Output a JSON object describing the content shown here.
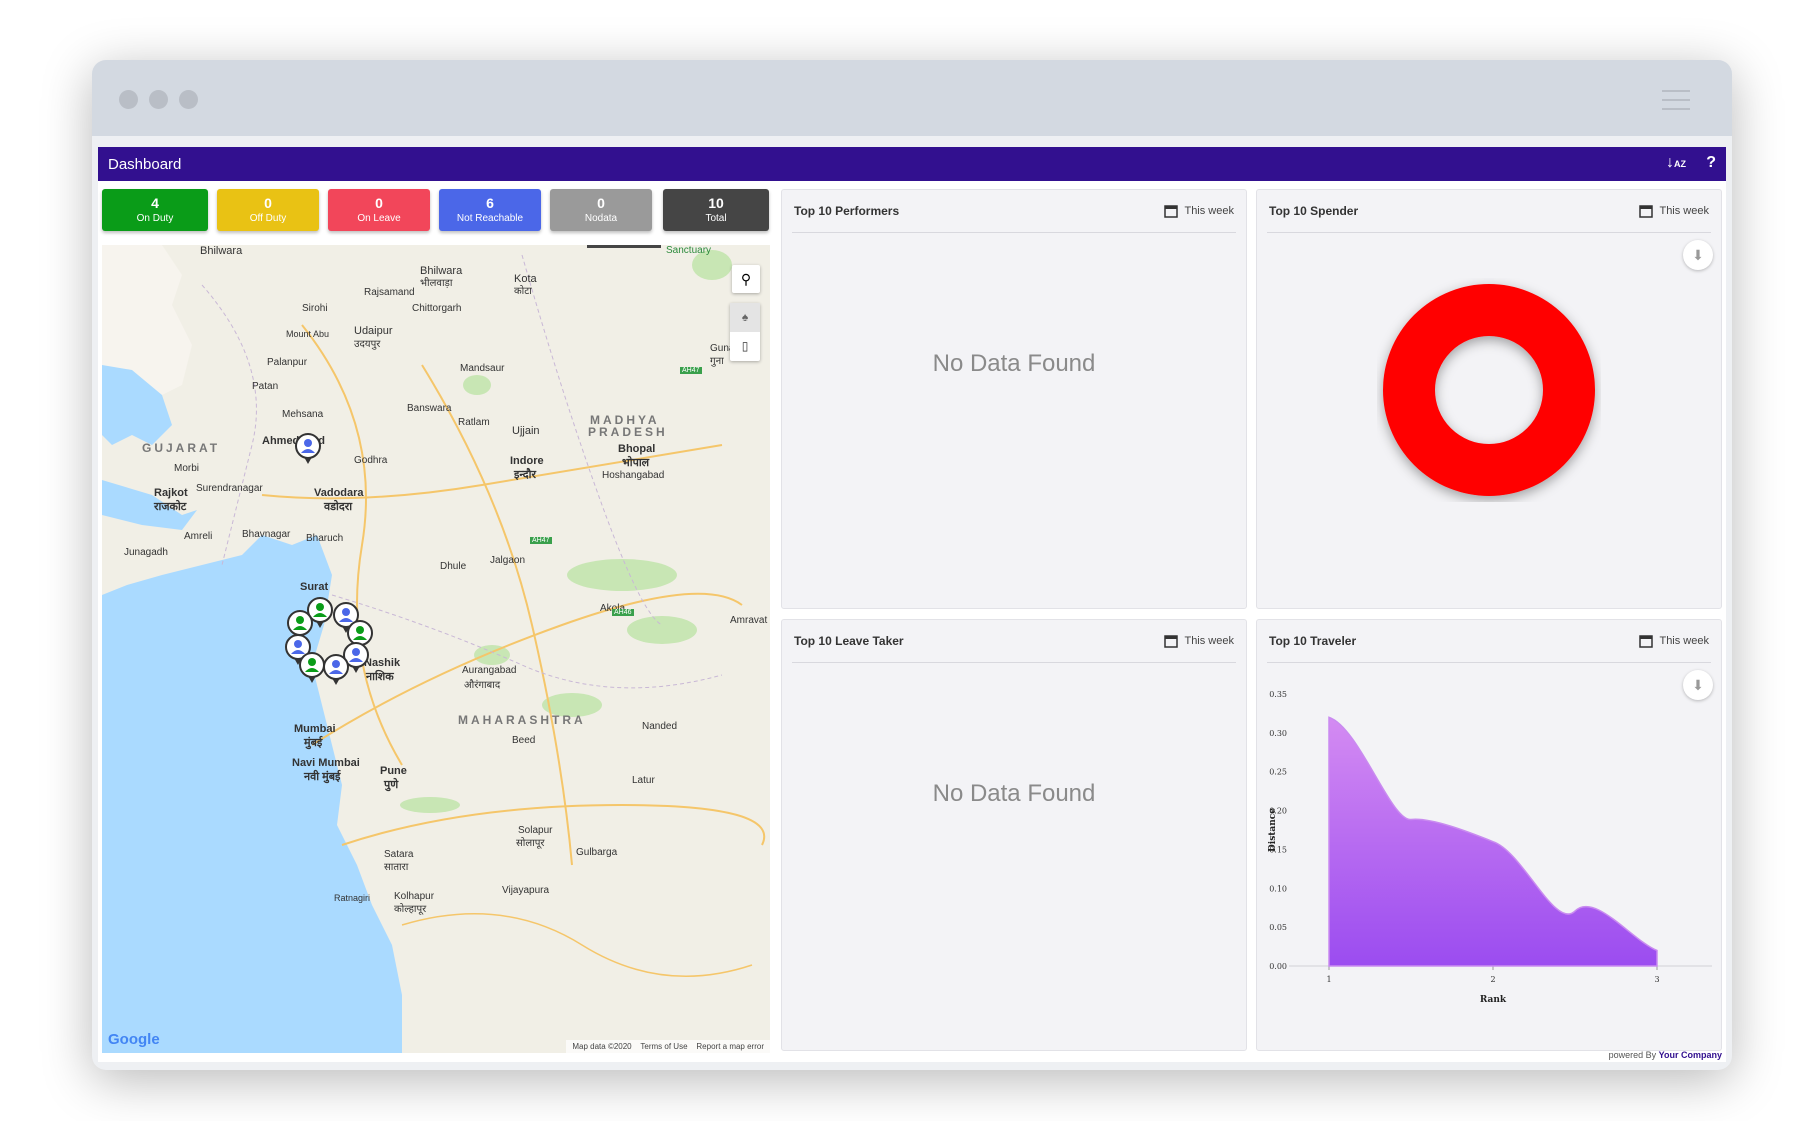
{
  "app": {
    "title": "Dashboard"
  },
  "status_cards": [
    {
      "value": "4",
      "label": "On Duty",
      "color": "#0a9c18"
    },
    {
      "value": "0",
      "label": "Off Duty",
      "color": "#e9c214"
    },
    {
      "value": "0",
      "label": "On Leave",
      "color": "#f2465a"
    },
    {
      "value": "6",
      "label": "Not Reachable",
      "color": "#4b67e8"
    },
    {
      "value": "0",
      "label": "Nodata",
      "color": "#9a9a9a"
    },
    {
      "value": "10",
      "label": "Total",
      "color": "#454545"
    }
  ],
  "map": {
    "places": [
      "Bhilwara",
      "भीलवाड़ा",
      "Kota",
      "कोटा",
      "Rajsamand",
      "Chittorgarh",
      "Sirohi",
      "Udaipur",
      "उदयपुर",
      "Mount Abu",
      "Palanpur",
      "Mandsaur",
      "Patan",
      "Banswara",
      "Mehsana",
      "Ratlam",
      "Ujjain",
      "Ahmedabad",
      "GUJARAT",
      "MADHYA",
      "PRADESH",
      "Bhopal",
      "भोपाल",
      "Indore",
      "इन्दौर",
      "Godhra",
      "Morbi",
      "Surendranagar",
      "Vadodara",
      "वडोदरा",
      "Rajkot",
      "राजकोट",
      "Hoshangabad",
      "Amreli",
      "Bhavnagar",
      "Bharuch",
      "Junagadh",
      "Surat",
      "Dhule",
      "Jalgaon",
      "Akola",
      "Amravat",
      "Nashik",
      "नाशिक",
      "Aurangabad",
      "औरंगाबाद",
      "MAHARASHTRA",
      "Mumbai",
      "मुंबई",
      "Navi Mumbai",
      "नवी मुंबई",
      "Pune",
      "पुणे",
      "Nanded",
      "Beed",
      "Latur",
      "Satara",
      "सातारा",
      "Solapur",
      "सोलापूर",
      "Gulbarga",
      "Kolhapur",
      "कोल्हापूर",
      "Vijayapura",
      "Ratnagiri",
      "Sanctuary",
      "Guna",
      "गुना",
      "AH47",
      "AH46"
    ],
    "google": "Google",
    "map_data": "Map data ©2020",
    "terms": "Terms of Use",
    "report": "Report a map error",
    "colors": {
      "water": "#aadaff",
      "land": "#f1efe6",
      "green": "#c8e6b4"
    }
  },
  "panels": {
    "performers": {
      "title": "Top 10 Performers",
      "range": "This week",
      "empty": "No Data Found"
    },
    "spender": {
      "title": "Top 10 Spender",
      "range": "This week"
    },
    "leave": {
      "title": "Top 10 Leave Taker",
      "range": "This week",
      "empty": "No Data Found"
    },
    "traveler": {
      "title": "Top 10 Traveler",
      "range": "This week"
    }
  },
  "chart_data": [
    {
      "type": "pie",
      "title": "",
      "slices": [
        {
          "value": 1,
          "color": "#ff0000"
        }
      ]
    },
    {
      "type": "area",
      "title": "",
      "xlabel": "Rank",
      "ylabel": "Distance",
      "x": [
        1,
        2,
        3
      ],
      "y": [
        0.32,
        0.16,
        0.02
      ],
      "xlim": [
        1,
        3
      ],
      "ylim": [
        0,
        0.35
      ],
      "yticks": [
        "0.00",
        "0.05",
        "0.10",
        "0.15",
        "0.20",
        "0.25",
        "0.30",
        "0.35"
      ],
      "xticks": [
        "1",
        "2",
        "3"
      ],
      "color_top": "#d48bf2",
      "color_bottom": "#9b4cf0"
    }
  ],
  "footer": {
    "powered": "powered By",
    "company": "Your Company"
  }
}
